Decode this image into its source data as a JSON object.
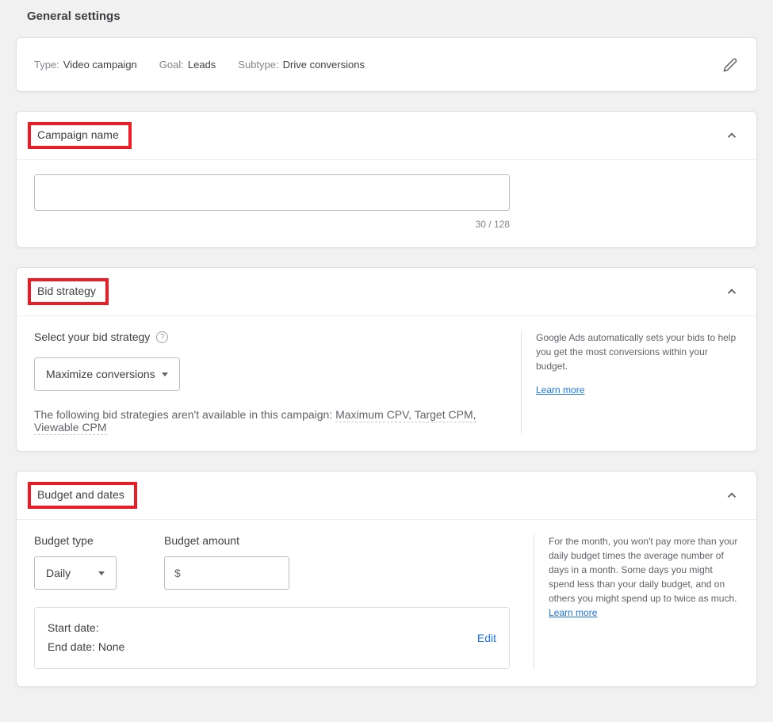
{
  "page_title": "General settings",
  "summary": {
    "type_label": "Type:",
    "type_value": "Video campaign",
    "goal_label": "Goal:",
    "goal_value": "Leads",
    "subtype_label": "Subtype:",
    "subtype_value": "Drive conversions"
  },
  "campaign_name": {
    "title": "Campaign name",
    "value": "",
    "counter": "30 / 128"
  },
  "bid_strategy": {
    "title": "Bid strategy",
    "select_label": "Select your bid strategy",
    "selected": "Maximize conversions",
    "note_prefix": "The following bid strategies aren't available in this campaign: ",
    "note_strategies": "Maximum CPV, Target CPM, Viewable CPM",
    "help_text": "Google Ads automatically sets your bids to help you get the most conversions within your budget.",
    "learn_more": "Learn more"
  },
  "budget_dates": {
    "title": "Budget and dates",
    "budget_type_label": "Budget type",
    "budget_type_value": "Daily",
    "budget_amount_label": "Budget amount",
    "currency_symbol": "$",
    "amount_value": "",
    "start_date_label": "Start date:",
    "end_date_label": "End date:",
    "end_date_value": "None",
    "edit_label": "Edit",
    "help_text": "For the month, you won't pay more than your daily budget times the average number of days in a month. Some days you might spend less than your daily budget, and on others you might spend up to twice as much.",
    "learn_more": "Learn more"
  }
}
